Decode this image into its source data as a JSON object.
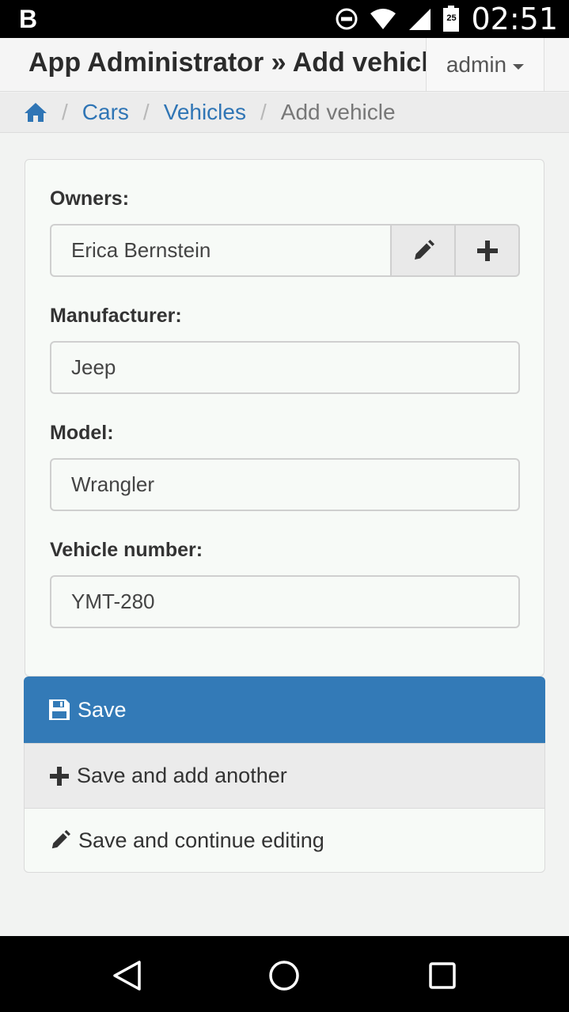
{
  "status_bar": {
    "notification_letter": "B",
    "time": "02:51",
    "battery_level": "25",
    "icons": [
      "dnd-icon",
      "wifi-icon",
      "signal-icon",
      "battery-icon"
    ]
  },
  "header": {
    "title": "App Administrator » Add vehicle",
    "user_menu": "admin"
  },
  "breadcrumb": {
    "home_icon": "home-icon",
    "items": [
      "Cars",
      "Vehicles",
      "Add vehicle"
    ]
  },
  "form": {
    "owners": {
      "label": "Owners:",
      "value": "Erica Bernstein"
    },
    "manufacturer": {
      "label": "Manufacturer:",
      "value": "Jeep"
    },
    "model": {
      "label": "Model:",
      "value": "Wrangler"
    },
    "vehicle_number": {
      "label": "Vehicle number:",
      "value": "YMT-280"
    }
  },
  "actions": {
    "save": "Save",
    "save_add_another": "Save and add another",
    "save_continue": "Save and continue editing"
  },
  "colors": {
    "primary": "#337ab7",
    "link": "#2f75b5"
  }
}
